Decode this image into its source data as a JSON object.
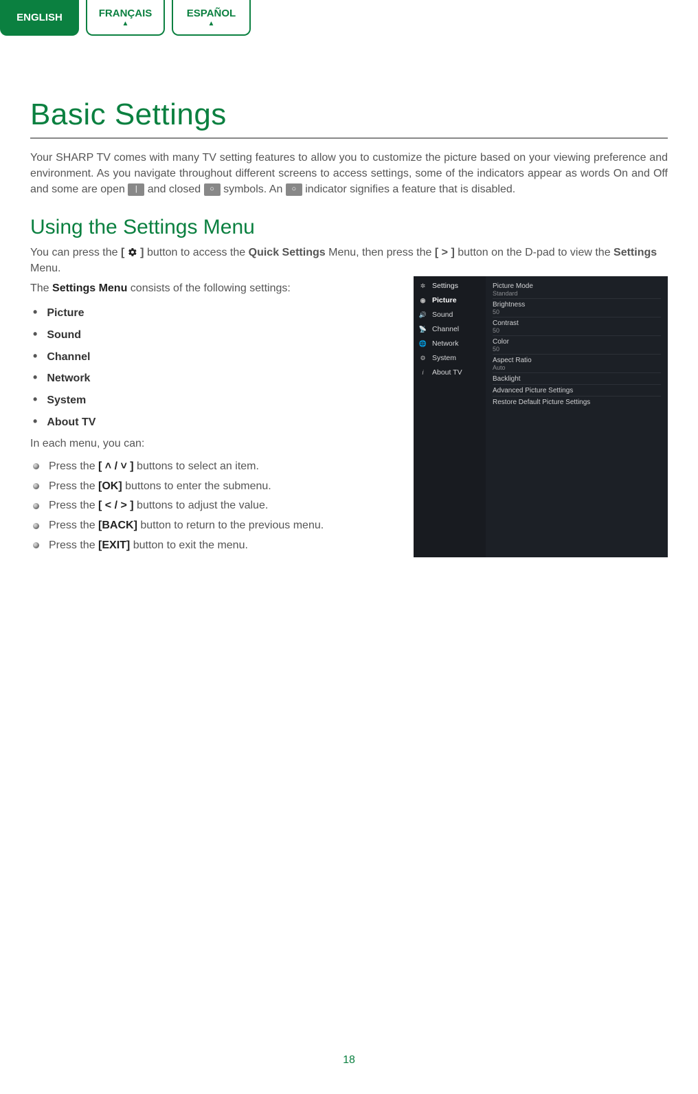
{
  "lang_tabs": {
    "english": "ENGLISH",
    "francais": "FRANÇAIS",
    "espanol": "ESPAÑOL"
  },
  "title": "Basic Settings",
  "intro": {
    "part1": "Your SHARP TV comes with many TV setting features to allow you to customize the picture based on your viewing preference and environment. As you navigate throughout different screens to access settings, some of the indicators appear as words On and Off and some are open ",
    "part2": " and closed ",
    "part3": " symbols. An ",
    "part4": " indicator signifies a feature that is disabled.",
    "icon_open": "|",
    "icon_closed": "○",
    "icon_disabled": "○"
  },
  "section2_title": "Using the Settings Menu",
  "para1": {
    "t1": "You can press the ",
    "b1_open": "[ ",
    "b1_close": " ]",
    "t2": " button to access the ",
    "b2": "Quick Settings",
    "t3": " Menu, then press the ",
    "b3": "[ > ]",
    "t4": " button on the D-pad to view the ",
    "b4": "Settings",
    "t5": " Menu."
  },
  "para2_t1": "The ",
  "para2_b": "Settings Menu",
  "para2_t2": " consists of the following settings:",
  "categories": [
    "Picture",
    "Sound",
    "Channel",
    "Network",
    "System",
    "About TV"
  ],
  "each_menu": "In each menu, you can:",
  "actions": [
    {
      "t1": "Press the ",
      "b": "[ ˄ / ˅ ]",
      "t2": " buttons to select an item."
    },
    {
      "t1": "Press the ",
      "b": "[OK]",
      "t2": " buttons to enter the submenu."
    },
    {
      "t1": "Press the ",
      "b": "[ < / > ]",
      "t2": " buttons to adjust the value."
    },
    {
      "t1": "Press the ",
      "b": "[BACK]",
      "t2": " button to return to the previous menu."
    },
    {
      "t1": "Press the ",
      "b": "[EXIT]",
      "t2": " button to exit the menu."
    }
  ],
  "tv": {
    "header": "Settings",
    "sidebar": [
      "Picture",
      "Sound",
      "Channel",
      "Network",
      "System",
      "About TV"
    ],
    "panel": [
      {
        "label": "Picture Mode",
        "val": "Standard"
      },
      {
        "label": "Brightness",
        "val": "50"
      },
      {
        "label": "Contrast",
        "val": "50"
      },
      {
        "label": "Color",
        "val": "50"
      },
      {
        "label": "Aspect Ratio",
        "val": "Auto"
      },
      {
        "label": "Backlight",
        "val": ""
      },
      {
        "label": "Advanced Picture Settings",
        "val": ""
      },
      {
        "label": "Restore Default Picture Settings",
        "val": ""
      }
    ]
  },
  "page_number": "18"
}
